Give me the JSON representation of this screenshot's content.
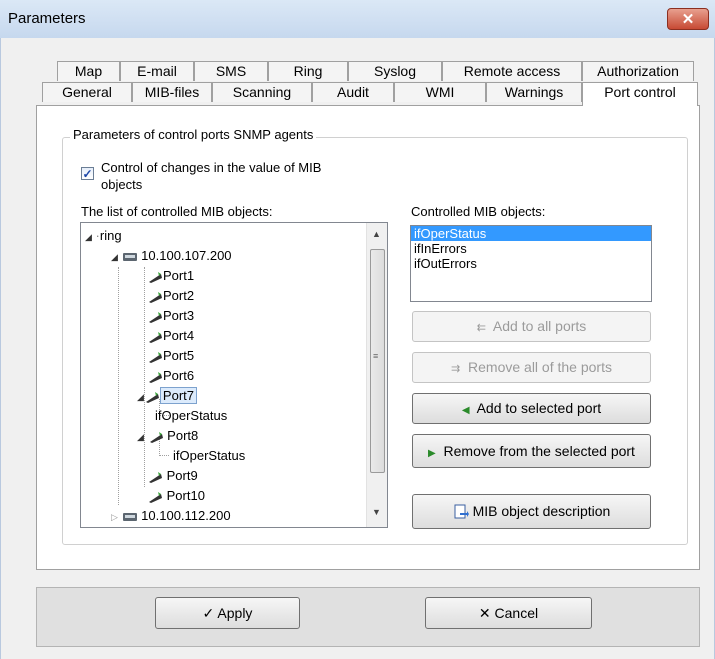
{
  "window": {
    "title": "Parameters",
    "close_glyph": "✕"
  },
  "tabs_row1": [
    "Map",
    "E-mail",
    "SMS",
    "Ring",
    "Syslog",
    "Remote access",
    "Authorization"
  ],
  "tabs_row2": [
    "General",
    "MIB-files",
    "Scanning",
    "Audit",
    "WMI",
    "Warnings",
    "Port control"
  ],
  "active_tab": "Port control",
  "group": {
    "legend": "Parameters of control ports SNMP agents",
    "checkbox_label_line1": "Control of changes in the value of MIB",
    "checkbox_label_line2": "objects",
    "checkbox_checked": true
  },
  "tree": {
    "label": "The list of controlled MIB objects:",
    "root": "ring",
    "host1": "10.100.107.200",
    "ports": [
      "Port1",
      "Port2",
      "Port3",
      "Port4",
      "Port5",
      "Port6",
      "Port7"
    ],
    "port7_child": "ifOperStatus",
    "port8": "Port8",
    "port8_child": "ifOperStatus",
    "port9": "Port9",
    "port10": "Port10",
    "host2": "10.100.112.200"
  },
  "controlled": {
    "label": "Controlled MIB objects:",
    "items": [
      "ifOperStatus",
      "ifInErrors",
      "ifOutErrors"
    ],
    "selected_index": 0
  },
  "buttons": {
    "add_all": "Add to all ports",
    "remove_all": "Remove all of the ports",
    "add_selected": "Add to selected port",
    "remove_selected": "Remove from the selected port",
    "description": "MIB object description",
    "apply": "Apply",
    "cancel": "Cancel"
  },
  "colors": {
    "selection": "#3399ff",
    "green_icon": "#3aa33a"
  }
}
